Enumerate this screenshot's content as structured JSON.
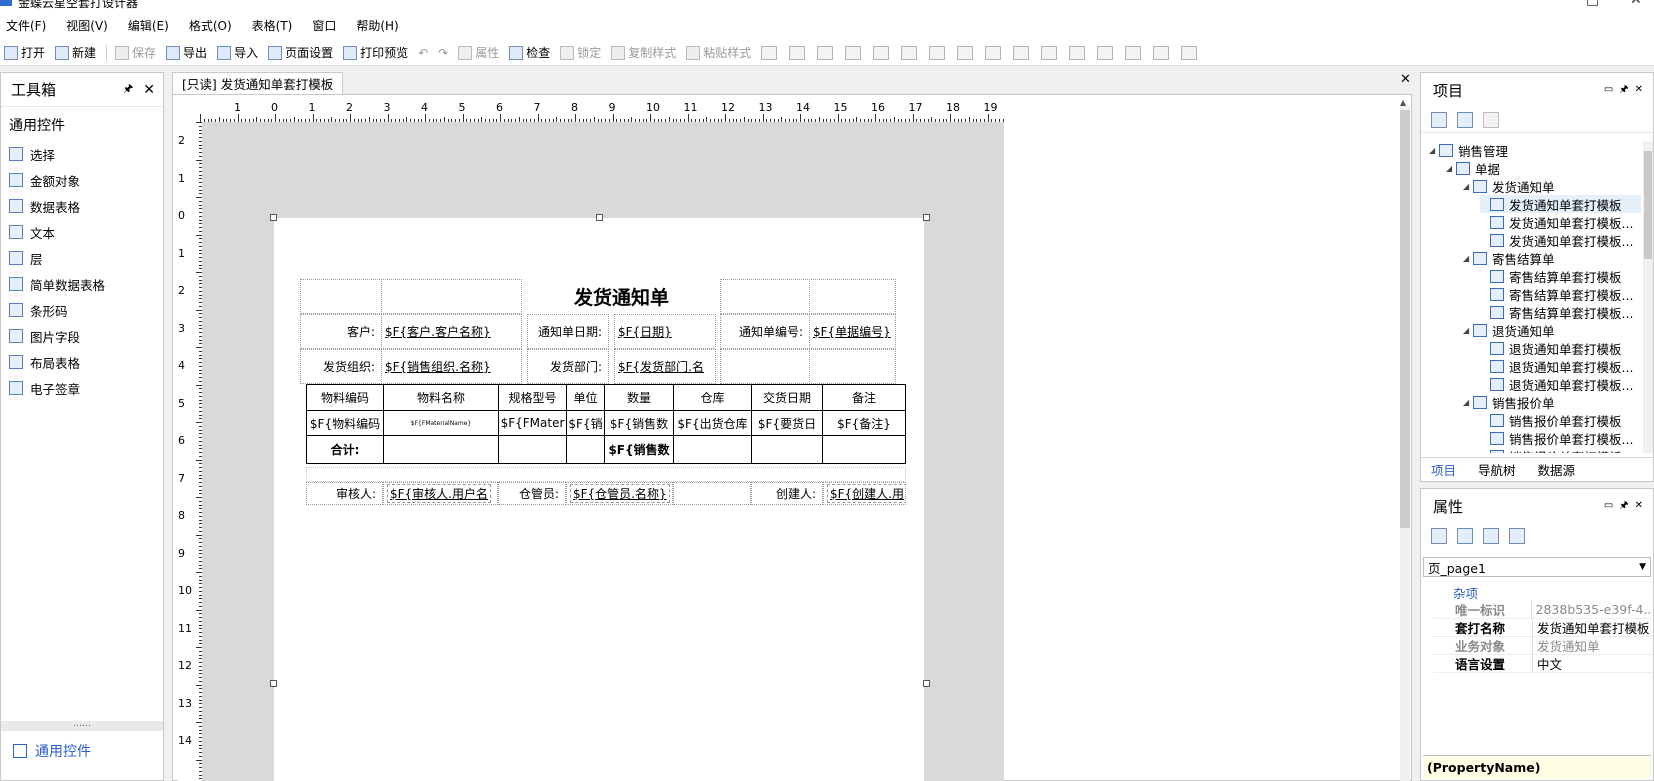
{
  "app": {
    "title": "金蝶云星空套打设计器"
  },
  "menu": [
    "文件(F)",
    "视图(V)",
    "编辑(E)",
    "格式(O)",
    "表格(T)",
    "窗口",
    "帮助(H)"
  ],
  "toolbar": {
    "open": "打开",
    "new": "新建",
    "save": "保存",
    "export": "导出",
    "import": "导入",
    "page_setup": "页面设置",
    "print_preview": "打印预览",
    "properties": "属性",
    "check": "检查",
    "lock": "锁定",
    "copy_style": "复制样式",
    "paste_style": "粘贴样式"
  },
  "toolbox": {
    "title": "工具箱",
    "group": "通用控件",
    "items": [
      "选择",
      "金额对象",
      "数据表格",
      "文本",
      "层",
      "简单数据表格",
      "条形码",
      "图片字段",
      "布局表格",
      "电子签章"
    ],
    "footer": "通用控件"
  },
  "document": {
    "tab": "[只读] 发货通知单套打模板"
  },
  "ruler": {
    "h": [
      "1",
      "0",
      "1",
      "2",
      "3",
      "4",
      "5",
      "6",
      "7",
      "8",
      "9",
      "10",
      "11",
      "12",
      "13",
      "14",
      "15",
      "16",
      "17",
      "18",
      "19"
    ],
    "v": [
      "2",
      "1",
      "0",
      "1",
      "2",
      "3",
      "4",
      "5",
      "6",
      "7",
      "8",
      "9",
      "10",
      "11",
      "12",
      "13",
      "14"
    ]
  },
  "report": {
    "title": "发货通知单",
    "customer_label": "客户:",
    "customer_field": "$F{客户.客户名称}",
    "date_label": "通知单日期:",
    "date_field": "$F{日期}",
    "no_label": "通知单编号:",
    "no_field": "$F{单据编号}",
    "org_label": "发货组织:",
    "org_field": "$F{销售组织.名称}",
    "dept_label": "发货部门:",
    "dept_field": "$F{发货部门.名",
    "columns": [
      "物料编码",
      "物料名称",
      "规格型号",
      "单位",
      "数量",
      "仓库",
      "交货日期",
      "备注"
    ],
    "row": [
      "$F{物料编码",
      "$F{FMaterialName}",
      "$F{FMater",
      "$F{销",
      "$F{销售数",
      "$F{出货仓库",
      "$F{要货日",
      "$F{备注}"
    ],
    "total_label": "合计:",
    "total_field": "$F{销售数",
    "reviewer_label": "审核人:",
    "reviewer_field": "$F{审核人.用户名",
    "keeper_label": "仓管员:",
    "keeper_field": "$F{仓管员.名称}",
    "creator_label": "创建人:",
    "creator_field": "$F{创建人.用"
  },
  "project": {
    "title": "项目",
    "tree": [
      {
        "label": "销售管理",
        "level": 0,
        "expand": true
      },
      {
        "label": "单据",
        "level": 1,
        "expand": true
      },
      {
        "label": "发货通知单",
        "level": 2,
        "expand": true
      },
      {
        "label": "发货通知单套打模板",
        "level": 3,
        "selected": true
      },
      {
        "label": "发货通知单套打模板...",
        "level": 3
      },
      {
        "label": "发货通知单套打模板...",
        "level": 3
      },
      {
        "label": "寄售结算单",
        "level": 2,
        "expand": true
      },
      {
        "label": "寄售结算单套打模板",
        "level": 3
      },
      {
        "label": "寄售结算单套打模板...",
        "level": 3
      },
      {
        "label": "寄售结算单套打模板...",
        "level": 3
      },
      {
        "label": "退货通知单",
        "level": 2,
        "expand": true
      },
      {
        "label": "退货通知单套打模板",
        "level": 3
      },
      {
        "label": "退货通知单套打模板...",
        "level": 3
      },
      {
        "label": "退货通知单套打模板...",
        "level": 3
      },
      {
        "label": "销售报价单",
        "level": 2,
        "expand": true
      },
      {
        "label": "销售报价单套打模板",
        "level": 3
      },
      {
        "label": "销售报价单套打模板...",
        "level": 3
      },
      {
        "label": "销售报价单套打模板...",
        "level": 3
      }
    ],
    "tabs": [
      "项目",
      "导航树",
      "数据源"
    ]
  },
  "properties": {
    "title": "属性",
    "object": "页_page1",
    "category": "杂项",
    "rows": [
      {
        "key": "唯一标识",
        "value": "2838b535-e39f-4...",
        "muted": true
      },
      {
        "key": "套打名称",
        "value": "发货通知单套打模板",
        "muted": false
      },
      {
        "key": "业务对象",
        "value": "发货通知单",
        "muted": true
      },
      {
        "key": "语言设置",
        "value": "中文",
        "muted": false
      }
    ],
    "description": "(PropertyName)"
  }
}
